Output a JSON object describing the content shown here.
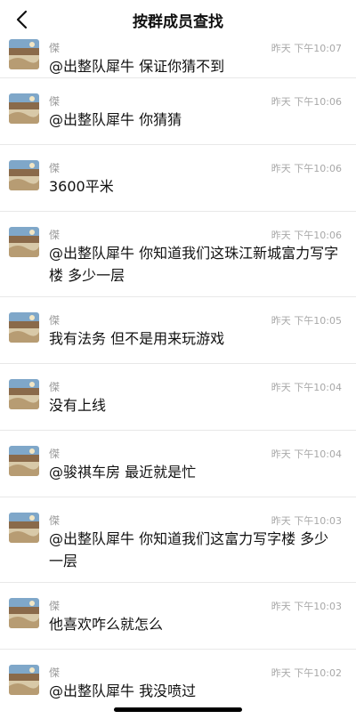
{
  "header": {
    "title": "按群成员查找",
    "back_icon": "chevron-left-icon"
  },
  "messages": [
    {
      "sender": "傑",
      "time": "昨天 下午10:07",
      "text": "@出整队犀牛 保证你猜不到"
    },
    {
      "sender": "傑",
      "time": "昨天 下午10:06",
      "text": "@出整队犀牛 你猜猜"
    },
    {
      "sender": "傑",
      "time": "昨天 下午10:06",
      "text": "3600平米"
    },
    {
      "sender": "傑",
      "time": "昨天 下午10:06",
      "text": "@出整队犀牛 你知道我们这珠江新城富力写字楼 多少一层"
    },
    {
      "sender": "傑",
      "time": "昨天 下午10:05",
      "text": "我有法务 但不是用来玩游戏"
    },
    {
      "sender": "傑",
      "time": "昨天 下午10:04",
      "text": "没有上线"
    },
    {
      "sender": "傑",
      "time": "昨天 下午10:04",
      "text": "@骏祺车房 最近就是忙"
    },
    {
      "sender": "傑",
      "time": "昨天 下午10:03",
      "text": "@出整队犀牛 你知道我们这富力写字楼 多少一层"
    },
    {
      "sender": "傑",
      "time": "昨天 下午10:03",
      "text": "他喜欢咋么就怎么"
    },
    {
      "sender": "傑",
      "time": "昨天 下午10:02",
      "text": "@出整队犀牛 我没喷过"
    }
  ]
}
